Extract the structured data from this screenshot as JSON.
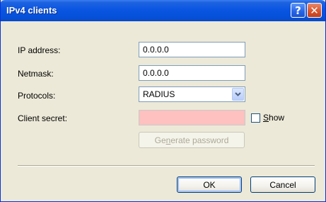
{
  "window": {
    "title": "IPv4 clients",
    "help_glyph": "?",
    "close_glyph": "✕"
  },
  "form": {
    "ip_address": {
      "label": "IP address:",
      "value": "0.0.0.0"
    },
    "netmask": {
      "label": "Netmask:",
      "value": "0.0.0.0"
    },
    "protocols": {
      "label": "Protocols:",
      "selected": "RADIUS"
    },
    "client_secret": {
      "label": "Client secret:",
      "value": "",
      "show_label_pre": "",
      "show_label_accel": "S",
      "show_label_post": "how",
      "show_checked": false
    },
    "generate": {
      "label_pre": "Ge",
      "label_accel": "n",
      "label_post": "erate password",
      "enabled": false
    }
  },
  "buttons": {
    "ok": "OK",
    "cancel": "Cancel"
  },
  "colors": {
    "titlebar": "#0651d9",
    "secret_field_bg": "#ffc0c0",
    "dialog_bg": "#ece9d8"
  }
}
